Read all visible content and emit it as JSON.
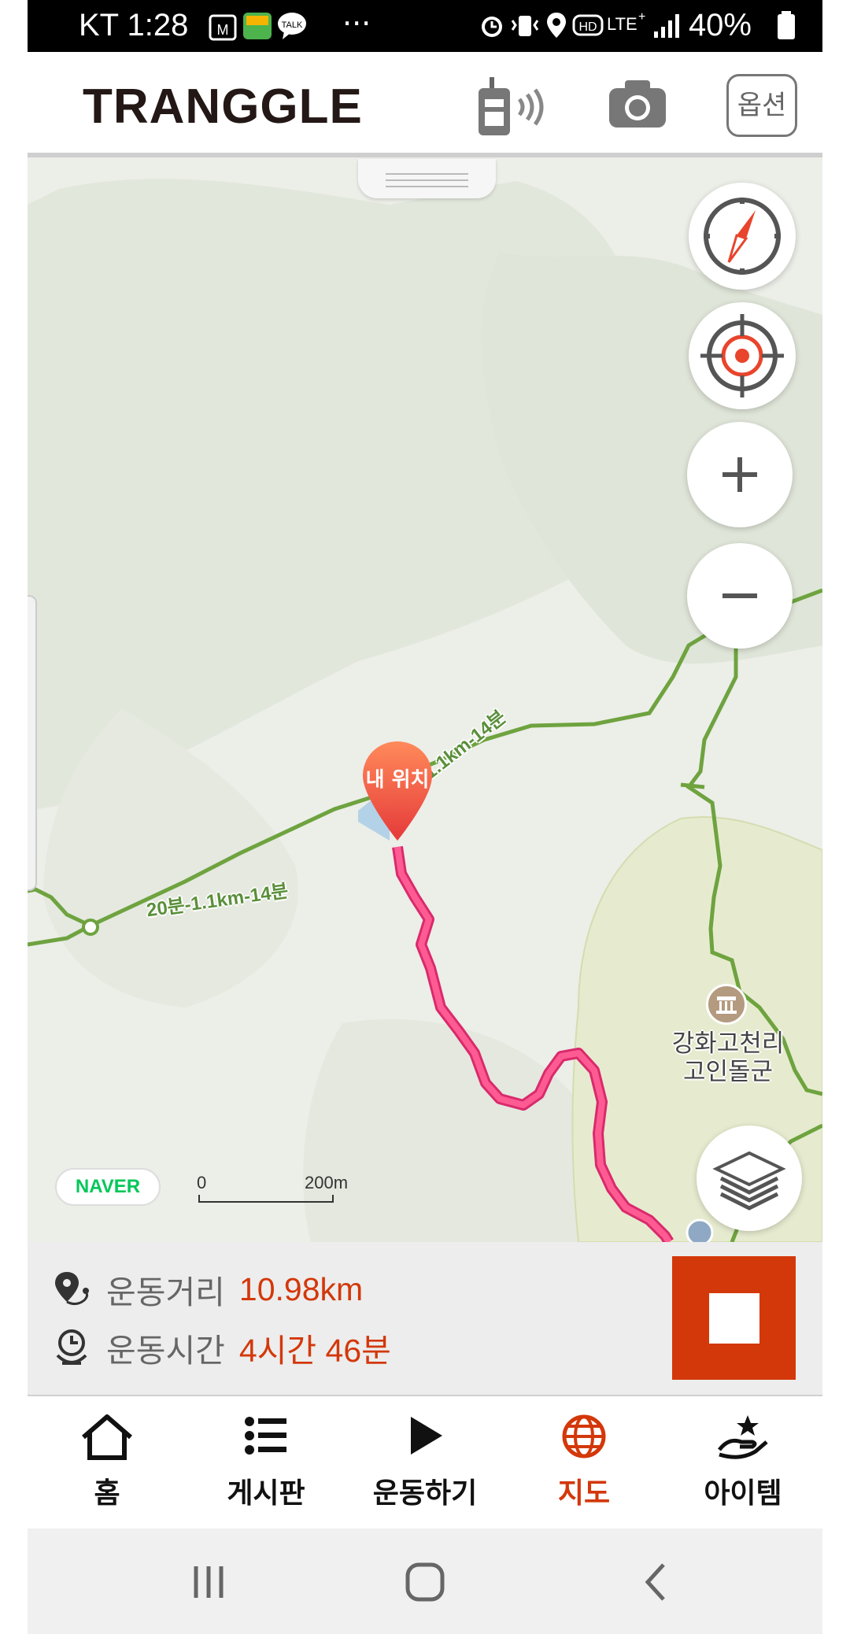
{
  "status_bar": {
    "carrier_time": "KT 1:28",
    "more_indicator": "···",
    "battery_percent": "40%",
    "icons": [
      "lock-m-icon",
      "app-icon",
      "talk-icon",
      "alarm-icon",
      "vibrate-icon",
      "location-icon",
      "hd-icon",
      "lte-plus-icon",
      "signal-icon",
      "battery-icon"
    ]
  },
  "header": {
    "logo": "TRANGGLE",
    "options_label": "옵션",
    "icons": [
      "walkie-talkie-icon",
      "camera-icon"
    ]
  },
  "map": {
    "marker_label": "내 위치",
    "trail_labels": [
      "20분-1.1km-14분",
      "20분-1.1km-14분"
    ],
    "poi": {
      "label": "강화고천리\n고인돌군",
      "icon": "landmark-icon"
    },
    "attribution": "NAVER",
    "scale": {
      "zero": "0",
      "distance": "200m"
    },
    "controls": [
      "compass-icon",
      "locate-me-icon",
      "zoom-in-icon",
      "zoom-out-icon",
      "layers-icon"
    ],
    "colors": {
      "trail": "#6ea33f",
      "route": "#ff3d7f",
      "background": "#eceee8",
      "park": "#e6ebcf"
    }
  },
  "stats": {
    "distance_label": "운동거리",
    "distance_value": "10.98km",
    "time_label": "운동시간",
    "time_value": "4시간 46분",
    "accent_color": "#d3380a"
  },
  "bottom_nav": {
    "items": [
      {
        "label": "홈",
        "icon": "home-icon"
      },
      {
        "label": "게시판",
        "icon": "list-icon"
      },
      {
        "label": "운동하기",
        "icon": "play-icon"
      },
      {
        "label": "지도",
        "icon": "globe-icon",
        "active": true
      },
      {
        "label": "아이템",
        "icon": "item-hand-star-icon"
      }
    ]
  },
  "system_nav": {
    "icons": [
      "recents-icon",
      "home-circle-icon",
      "back-icon"
    ]
  }
}
